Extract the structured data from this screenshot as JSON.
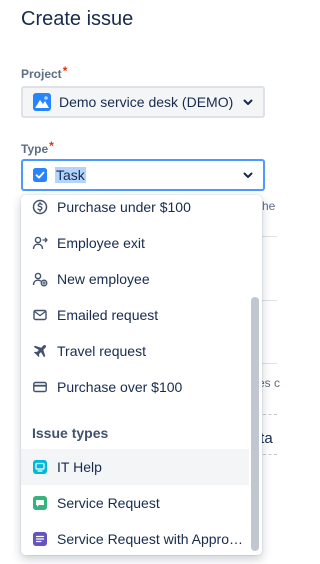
{
  "page": {
    "title": "Create issue"
  },
  "project_field": {
    "label": "Project",
    "required_mark": "*",
    "value": "Demo service desk (DEMO)",
    "icon": "project-avatar-icon"
  },
  "type_field": {
    "label": "Type",
    "required_mark": "*",
    "value": "Task",
    "icon": "task-checkbox-icon"
  },
  "background_peek": {
    "text_1": "he",
    "text_2": "es c",
    "text_3": "tta"
  },
  "menu": {
    "request_types": [
      {
        "label": "Purchase under $100",
        "icon": "dollar-circle-icon"
      },
      {
        "label": "Employee exit",
        "icon": "person-exit-icon"
      },
      {
        "label": "New employee",
        "icon": "person-add-icon"
      },
      {
        "label": "Emailed request",
        "icon": "envelope-icon"
      },
      {
        "label": "Travel request",
        "icon": "airplane-icon"
      },
      {
        "label": "Purchase over $100",
        "icon": "credit-card-icon"
      }
    ],
    "group_heading": "Issue types",
    "issue_types": [
      {
        "label": "IT Help",
        "icon": "it-help-icon",
        "color": "#00b8d9"
      },
      {
        "label": "Service Request",
        "icon": "service-request-icon",
        "color": "#36b37e"
      },
      {
        "label": "Service Request with Approvals",
        "icon": "service-request-approvals-icon",
        "color": "#6554c0"
      }
    ]
  },
  "colors": {
    "accent_border": "#4c9aff",
    "required": "#de350b",
    "selection_highlight": "#b3d4ff",
    "task_icon": "#2684ff"
  }
}
